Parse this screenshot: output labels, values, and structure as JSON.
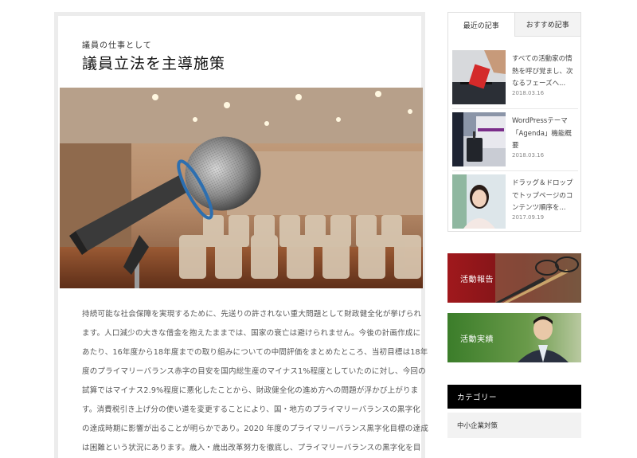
{
  "article": {
    "kicker": "議員の仕事として",
    "title": "議員立法を主導施策",
    "paragraph_lines": [
      "持続可能な社会保障を実現するために、先送りの許されない重大問題として財政健全化が挙げられ",
      "ます。人口減少の大きな借金を抱えたままでは、国家の衰亡は避けられません。今後の計画作成に",
      "あたり、16年度から18年度までの取り組みについての中間評価をまとめたところ、当初目標は18年",
      "度のプライマリーバランス赤字の目安を国内総生産のマイナス1%程度としていたのに対し、今回の",
      "試算ではマイナス2.9%程度に悪化したことから、財政健全化の進め方への問題が浮かび上がりま",
      "す。消費税引き上げ分の使い道を変更することにより、国・地方のプライマリーバランスの黒字化",
      "の達成時期に影響が出ることが明らかであり。2020 年度のプライマリーバランス黒字化目標の達成",
      "は困難という状況にあります。歳入・歳出改革努力を徹底し、プライマリーバランスの黒字化を目"
    ]
  },
  "sidebar": {
    "tabs": [
      {
        "label": "最近の記事"
      },
      {
        "label": "おすすめ記事"
      }
    ],
    "posts": [
      {
        "title": "すべての活動家の情熱を呼び覚まし、次なるフェーズへ...",
        "date": "2018.03.16"
      },
      {
        "title": "WordPressテーマ「Agenda」機能概要",
        "date": "2018.03.16"
      },
      {
        "title": "ドラッグ＆ドロップでトップページのコンテンツ順序を...",
        "date": "2017.09.19"
      }
    ],
    "banners": [
      {
        "label": "活動報告"
      },
      {
        "label": "活動実績"
      }
    ],
    "category_heading": "カテゴリー",
    "categories": [
      {
        "label": "中小企業対策"
      }
    ]
  },
  "colors": {
    "card_border": "#ececec",
    "category_bg": "#000000",
    "banner_red": "#8e1a1c",
    "banner_green": "#3f7d2c"
  }
}
